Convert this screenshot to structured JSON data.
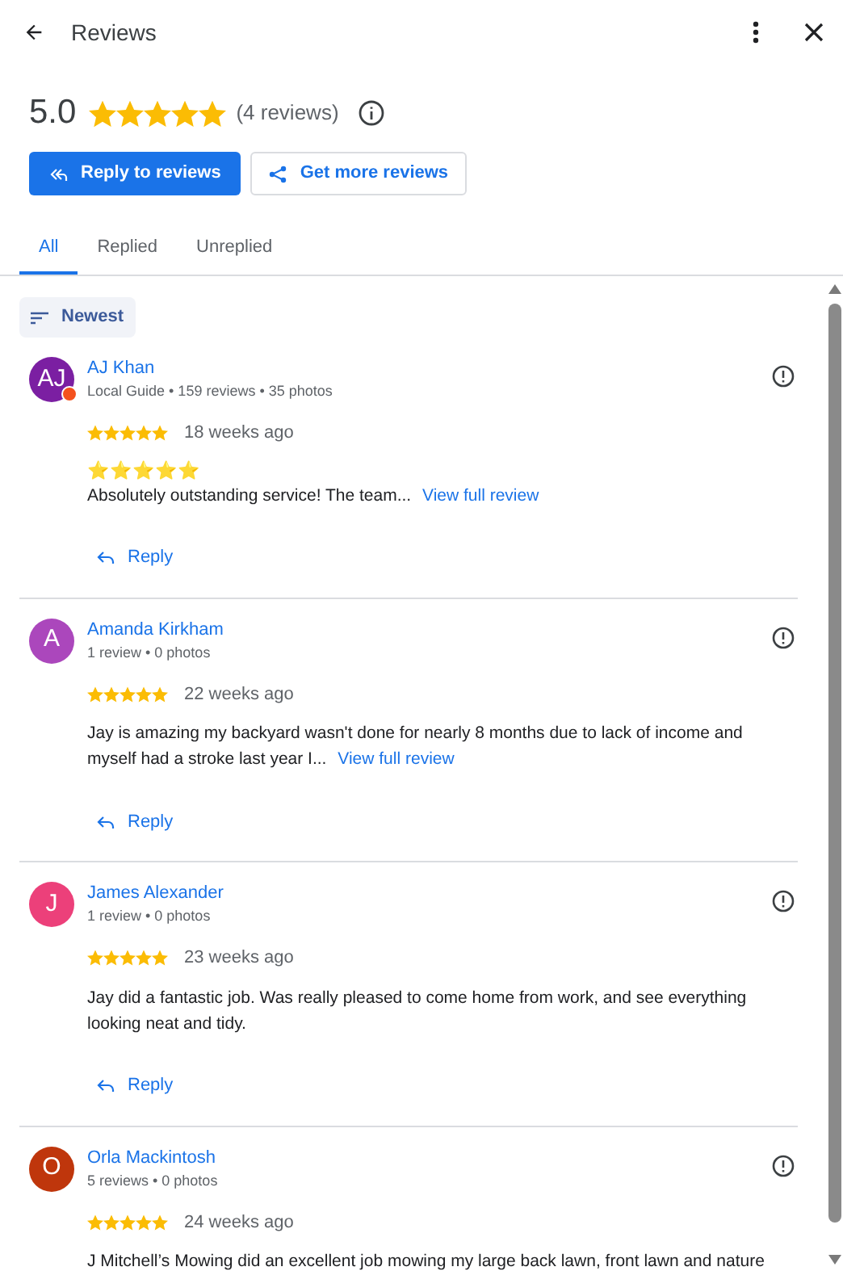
{
  "header": {
    "title": "Reviews"
  },
  "summary": {
    "rating": "5.0",
    "stars": 5,
    "count": "(4 reviews)"
  },
  "actions": [
    "Reply to reviews",
    "Get more reviews"
  ],
  "tabs": [
    {
      "label": "All",
      "selected": true
    },
    {
      "label": "Replied",
      "selected": false
    },
    {
      "label": "Unreplied",
      "selected": false
    }
  ],
  "sort": {
    "label": "Newest"
  },
  "reviews": [
    {
      "initial": "AJ",
      "color": "#7b1fa2",
      "local_guide_badge": true,
      "name": "AJ Khan",
      "meta": "Local Guide • 159 reviews • 35 photos",
      "stars": 5,
      "time": "18 weeks ago",
      "emoji_line": "⭐⭐⭐⭐⭐",
      "text": "Absolutely outstanding service! The team...",
      "link": "View full review",
      "reply": "Reply"
    },
    {
      "initial": "A",
      "color": "#ab47bc",
      "local_guide_badge": false,
      "name": "Amanda Kirkham",
      "meta": "1 review • 0 photos",
      "stars": 5,
      "time": "22 weeks ago",
      "text": "Jay is amazing my backyard wasn't done for nearly 8 months due to lack of income and myself had a stroke last year I...",
      "link": "View full review",
      "reply": "Reply"
    },
    {
      "initial": "J",
      "color": "#ec407a",
      "local_guide_badge": false,
      "name": "James Alexander",
      "meta": "1 review • 0 photos",
      "stars": 5,
      "time": "23 weeks ago",
      "text": "Jay did a fantastic job. Was really pleased to come home from work, and see everything looking neat and tidy.",
      "reply": "Reply"
    },
    {
      "initial": "O",
      "color": "#bf360c",
      "local_guide_badge": false,
      "name": "Orla Mackintosh",
      "meta": "5 reviews • 0 photos",
      "stars": 5,
      "time": "24 weeks ago",
      "text": "J Mitchell’s Mowing did an excellent job mowing my large back lawn, front lawn and nature"
    }
  ]
}
